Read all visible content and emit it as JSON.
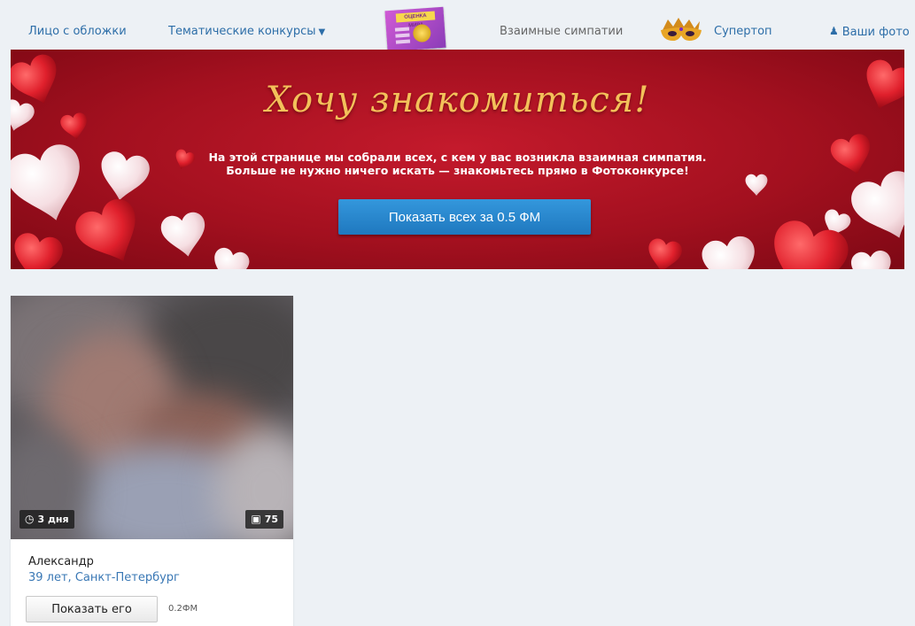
{
  "nav": {
    "cover_face": "Лицо с обложки",
    "themed_contests": "Тематические конкурсы",
    "mutual_likes": "Взаимные симпатии",
    "supertop": "Супертоп",
    "your_photos": "Ваши фото",
    "magazine_text": "ОЦЕНКА МИРА"
  },
  "hero": {
    "title": "Хочу знакомиться!",
    "line1": "На этой странице мы собрали всех, с кем у вас возникла взаимная симпатия.",
    "line2": "Больше не нужно ничего искать — знакомьтесь прямо в Фотоконкурсе!",
    "button": "Показать всех за 0.5 ФМ"
  },
  "profile": {
    "time_left": "3 дня",
    "photo_count": "75",
    "name": "Александр",
    "details": "39 лет, Санкт-Петербург",
    "button": "Показать его",
    "price": "0.2ФМ"
  },
  "colors": {
    "link": "#2d6ea8",
    "banner_red": "#b0121f",
    "title_gold": "#f3c15a",
    "button_blue": "#1f78bf"
  },
  "icons": [
    "chevron-down-icon",
    "user-icon",
    "magazine-icon",
    "mask-icon",
    "clock-icon",
    "camera-icon"
  ]
}
